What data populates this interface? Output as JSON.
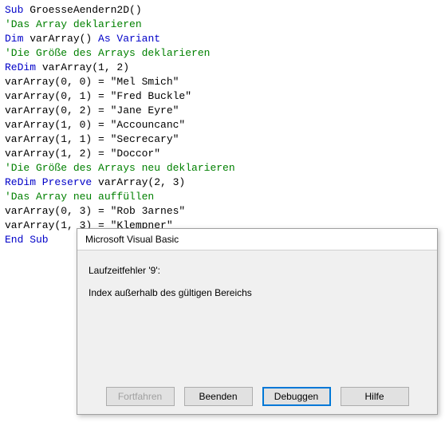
{
  "code": {
    "lines": [
      {
        "segments": [
          {
            "cls": "kw",
            "t": "Sub"
          },
          {
            "cls": "txt",
            "t": " GroesseAendern2D()"
          }
        ]
      },
      {
        "segments": [
          {
            "cls": "comment",
            "t": "'Das Array deklarieren"
          }
        ]
      },
      {
        "segments": [
          {
            "cls": "kw",
            "t": "Dim"
          },
          {
            "cls": "txt",
            "t": " varArray() "
          },
          {
            "cls": "kw",
            "t": "As Variant"
          }
        ]
      },
      {
        "segments": [
          {
            "cls": "comment",
            "t": "'Die Größe des Arrays deklarieren"
          }
        ]
      },
      {
        "segments": [
          {
            "cls": "kw",
            "t": "ReDim"
          },
          {
            "cls": "txt",
            "t": " varArray(1, 2)"
          }
        ]
      },
      {
        "segments": [
          {
            "cls": "txt",
            "t": "varArray(0, 0) = \"Mel Smich\""
          }
        ]
      },
      {
        "segments": [
          {
            "cls": "txt",
            "t": "varArray(0, 1) = \"Fred Buckle\""
          }
        ]
      },
      {
        "segments": [
          {
            "cls": "txt",
            "t": "varArray(0, 2) = \"Jane Eyre\""
          }
        ]
      },
      {
        "segments": [
          {
            "cls": "txt",
            "t": "varArray(1, 0) = \"Accouncanc\""
          }
        ]
      },
      {
        "segments": [
          {
            "cls": "txt",
            "t": "varArray(1, 1) = \"Secrecary\""
          }
        ]
      },
      {
        "segments": [
          {
            "cls": "txt",
            "t": "varArray(1, 2) = \"Doccor\""
          }
        ]
      },
      {
        "segments": [
          {
            "cls": "comment",
            "t": "'Die Größe des Arrays neu deklarieren"
          }
        ]
      },
      {
        "segments": [
          {
            "cls": "kw",
            "t": "ReDim Preserve"
          },
          {
            "cls": "txt",
            "t": " varArray(2, 3)"
          }
        ]
      },
      {
        "segments": [
          {
            "cls": "comment",
            "t": "'Das Array neu auffüllen"
          }
        ]
      },
      {
        "segments": [
          {
            "cls": "txt",
            "t": "varArray(0, 3) = \"Rob 3arnes\""
          }
        ]
      },
      {
        "segments": [
          {
            "cls": "txt",
            "t": "varArray(1, 3) = \"Klempner\""
          }
        ]
      },
      {
        "segments": [
          {
            "cls": "kw",
            "t": "End Sub"
          }
        ]
      }
    ]
  },
  "dialog": {
    "title": "Microsoft Visual Basic",
    "error_label": "Laufzeitfehler '9':",
    "error_msg": "Index außerhalb des gültigen Bereichs",
    "buttons": {
      "continue": "Fortfahren",
      "end": "Beenden",
      "debug": "Debuggen",
      "help": "Hilfe"
    }
  }
}
